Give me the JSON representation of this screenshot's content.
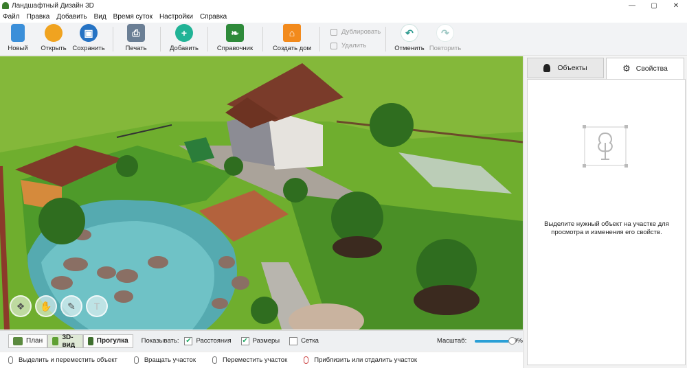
{
  "window": {
    "title": "Ландшафтный Дизайн 3D",
    "minimize": "—",
    "maximize": "▢",
    "close": "✕"
  },
  "menu": [
    "Файл",
    "Правка",
    "Добавить",
    "Вид",
    "Время суток",
    "Настройки",
    "Справка"
  ],
  "toolbar": {
    "new": "Новый",
    "open": "Открыть",
    "save": "Сохранить",
    "print": "Печать",
    "add": "Добавить",
    "reference": "Справочник",
    "build_house": "Создать дом",
    "duplicate": "Дублировать",
    "delete": "Удалить",
    "undo": "Отменить",
    "redo": "Повторить"
  },
  "colors": {
    "new": "#3b8fd9",
    "open": "#f0a320",
    "save": "#2673c4",
    "print": "#6b7f95",
    "add": "#21b396",
    "reference": "#2e8a3a",
    "build_house": "#f28a1c",
    "undo": "#2c9a8f",
    "redo": "#9fc8c4"
  },
  "viewport_tools": {
    "icons": [
      "layers-icon",
      "hand-icon",
      "ruler-icon",
      "text-icon"
    ]
  },
  "view_tabs": {
    "plan": "План",
    "view3d": "3D-вид",
    "walk": "Прогулка",
    "active": "3D-вид"
  },
  "show": {
    "label": "Показывать:",
    "distances": "Расстояния",
    "sizes": "Размеры",
    "grid": "Сетка",
    "distances_checked": true,
    "sizes_checked": true,
    "grid_checked": false
  },
  "scale": {
    "label": "Масштаб:",
    "value": "89%",
    "fraction": 0.89
  },
  "status": [
    "Выделить и переместить объект",
    "Вращать участок",
    "Переместить участок",
    "Приблизить или отдалить участок"
  ],
  "panel": {
    "tab_objects": "Объекты",
    "tab_properties": "Свойства",
    "active_tab": "Свойства",
    "hint_line1": "Выделите нужный объект на участке для",
    "hint_line2": "просмотра и изменения его свойств."
  }
}
